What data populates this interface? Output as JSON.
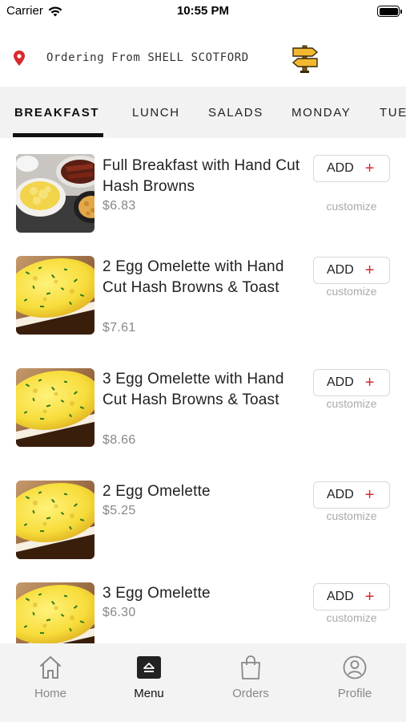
{
  "status_bar": {
    "carrier": "Carrier",
    "time": "10:55 PM"
  },
  "location": {
    "label": "Ordering From SHELL SCOTFORD",
    "pin_color": "#d62b2b",
    "signpost_color": "#f2b830"
  },
  "tabs": [
    {
      "label": "BREAKFAST",
      "active": true
    },
    {
      "label": "LUNCH",
      "active": false
    },
    {
      "label": "SALADS",
      "active": false
    },
    {
      "label": "MONDAY",
      "active": false
    },
    {
      "label": "TUE",
      "active": false
    }
  ],
  "menu": {
    "add_label": "ADD",
    "customize_label": "customize",
    "accent_color": "#d62b2b",
    "items": [
      {
        "name": "Full Breakfast with Hand Cut Hash Browns",
        "price": "$6.83",
        "image": "full-breakfast-image"
      },
      {
        "name": "2 Egg Omelette with Hand Cut Hash Browns & Toast",
        "price": "$7.61",
        "image": "omelette-image"
      },
      {
        "name": "3 Egg Omelette with Hand Cut Hash Browns & Toast",
        "price": "$8.66",
        "image": "omelette-image"
      },
      {
        "name": "2 Egg Omelette",
        "price": "$5.25",
        "image": "omelette-image"
      },
      {
        "name": "3 Egg Omelette",
        "price": "$6.30",
        "image": "omelette-image"
      }
    ]
  },
  "bottom_nav": [
    {
      "label": "Home",
      "icon": "home-icon",
      "active": false
    },
    {
      "label": "Menu",
      "icon": "menu-icon",
      "active": true
    },
    {
      "label": "Orders",
      "icon": "shopping-bag-icon",
      "active": false
    },
    {
      "label": "Profile",
      "icon": "profile-icon",
      "active": false
    }
  ]
}
